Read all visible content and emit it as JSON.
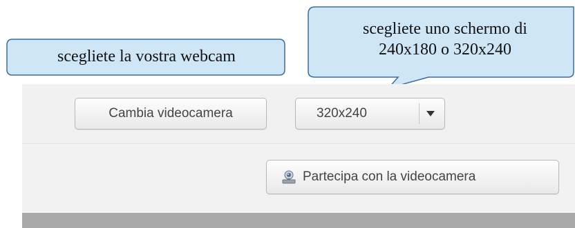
{
  "callouts": {
    "webcam": "scegliete la vostra webcam",
    "resolution_line1": "scegliete uno schermo di",
    "resolution_line2": "240x180 o 320x240"
  },
  "toolbar": {
    "change_camera_label": "Cambia videocamera",
    "resolution_selected": "320x240",
    "resolution_dropdown_icon": "caret-down-icon",
    "join_with_camera_label": "Partecipa con la videocamera",
    "join_icon": "webcam-icon"
  },
  "colors": {
    "callout_fill": "#cfe6f7",
    "callout_stroke": "#3d6b9c",
    "panel_bg": "#f1f1f1",
    "bottom_bar": "#a9a9a9",
    "button_text": "#444444"
  }
}
